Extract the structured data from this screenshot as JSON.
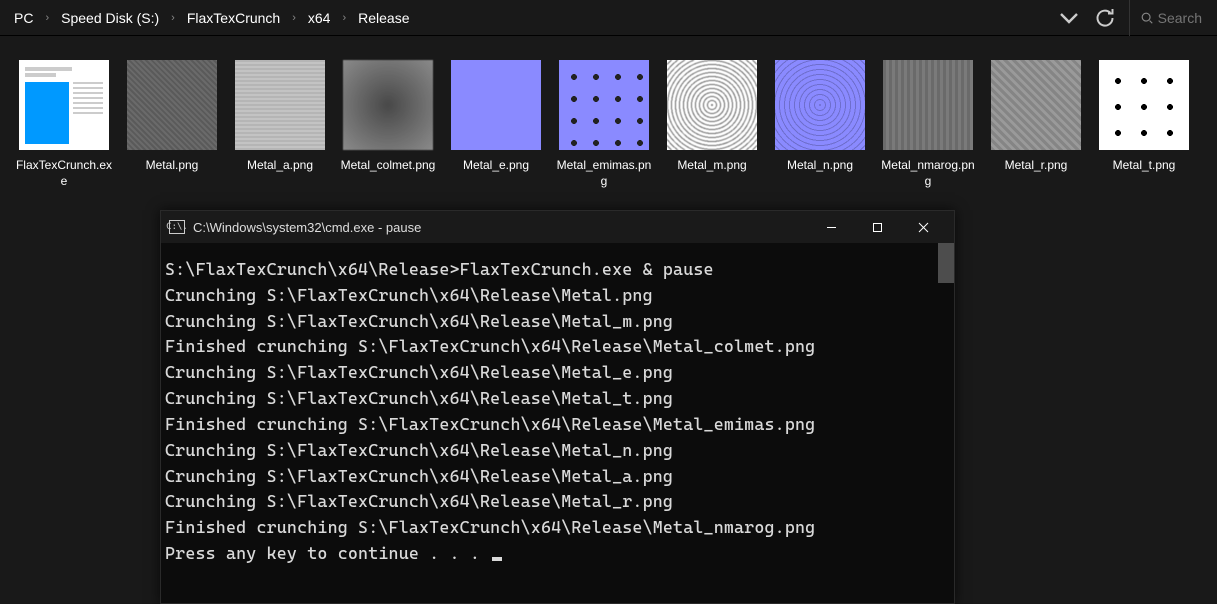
{
  "breadcrumb": {
    "items": [
      "PC",
      "Speed Disk (S:)",
      "FlaxTexCrunch",
      "x64",
      "Release"
    ]
  },
  "search": {
    "placeholder": "Search"
  },
  "files": [
    {
      "label": "FlaxTexCrunch.exe",
      "thumb": "exe"
    },
    {
      "label": "Metal.png",
      "thumb": "grey1"
    },
    {
      "label": "Metal_a.png",
      "thumb": "grey2"
    },
    {
      "label": "Metal_colmet.png",
      "thumb": "grey3"
    },
    {
      "label": "Metal_e.png",
      "thumb": "blue"
    },
    {
      "label": "Metal_emimas.png",
      "thumb": "bluedots"
    },
    {
      "label": "Metal_m.png",
      "thumb": "noise"
    },
    {
      "label": "Metal_n.png",
      "thumb": "bluenoise"
    },
    {
      "label": "Metal_nmarog.png",
      "thumb": "grey4"
    },
    {
      "label": "Metal_r.png",
      "thumb": "grey5"
    },
    {
      "label": "Metal_t.png",
      "thumb": "whitedots"
    }
  ],
  "console": {
    "title": "C:\\Windows\\system32\\cmd.exe - pause",
    "icon_text": "C:\\.",
    "lines": [
      "",
      "S:\\FlaxTexCrunch\\x64\\Release>FlaxTexCrunch.exe & pause",
      "Crunching S:\\FlaxTexCrunch\\x64\\Release\\Metal.png",
      "Crunching S:\\FlaxTexCrunch\\x64\\Release\\Metal_m.png",
      "Finished crunching S:\\FlaxTexCrunch\\x64\\Release\\Metal_colmet.png",
      "Crunching S:\\FlaxTexCrunch\\x64\\Release\\Metal_e.png",
      "Crunching S:\\FlaxTexCrunch\\x64\\Release\\Metal_t.png",
      "Finished crunching S:\\FlaxTexCrunch\\x64\\Release\\Metal_emimas.png",
      "Crunching S:\\FlaxTexCrunch\\x64\\Release\\Metal_n.png",
      "Crunching S:\\FlaxTexCrunch\\x64\\Release\\Metal_a.png",
      "Crunching S:\\FlaxTexCrunch\\x64\\Release\\Metal_r.png",
      "Finished crunching S:\\FlaxTexCrunch\\x64\\Release\\Metal_nmarog.png",
      "Press any key to continue . . . "
    ]
  }
}
